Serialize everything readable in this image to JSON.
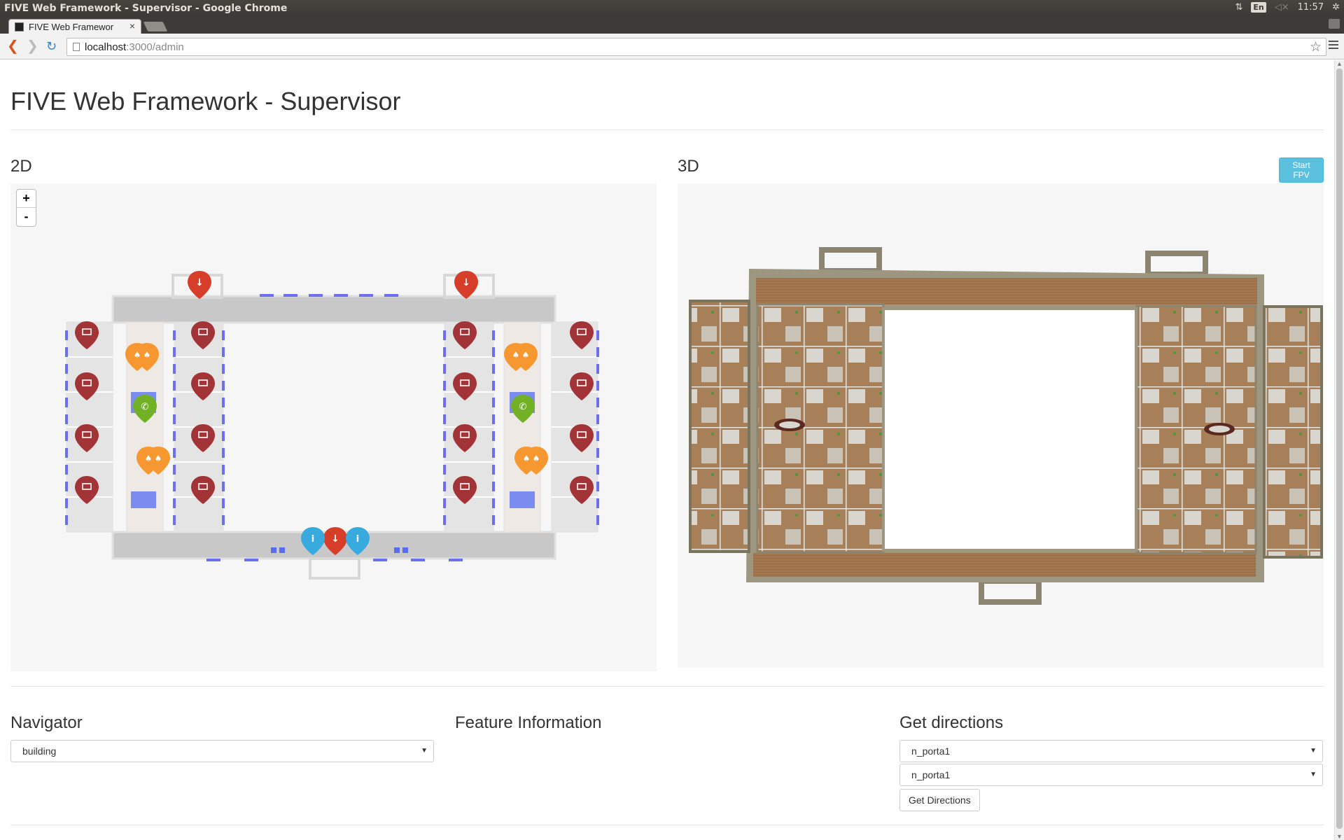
{
  "os": {
    "window_title": "FIVE Web Framework - Supervisor - Google Chrome",
    "keyboard_layout": "En",
    "clock": "11:57"
  },
  "browser": {
    "tab_title": "FIVE Web Framewor",
    "tab_close": "×",
    "url_host": "localhost",
    "url_path": ":3000/admin",
    "back_glyph": "❮",
    "forward_glyph": "❯",
    "reload_glyph": "↻",
    "star_glyph": "☆"
  },
  "page": {
    "title": "FIVE Web Framework - Supervisor",
    "panel_2d_heading": "2D",
    "panel_3d_heading": "3D",
    "start_fpv_label": "Start FPV",
    "zoom_in_label": "+",
    "zoom_out_label": "-",
    "navigator": {
      "label": "Navigator",
      "selected": "building"
    },
    "feature_info": {
      "label": "Feature Information"
    },
    "directions": {
      "label": "Get directions",
      "from_selected": "n_porta1",
      "to_selected": "n_porta1",
      "button_label": "Get Directions"
    }
  },
  "icons": {
    "marker_colors": {
      "door": "#d63e2a",
      "workstation": "#a23336",
      "info": "#38aadd",
      "phone": "#72b026",
      "fire": "#f69730"
    },
    "marker_types": [
      "down-arrow-icon",
      "monitor-icon",
      "info-icon",
      "phone-icon",
      "fire-icon"
    ]
  }
}
